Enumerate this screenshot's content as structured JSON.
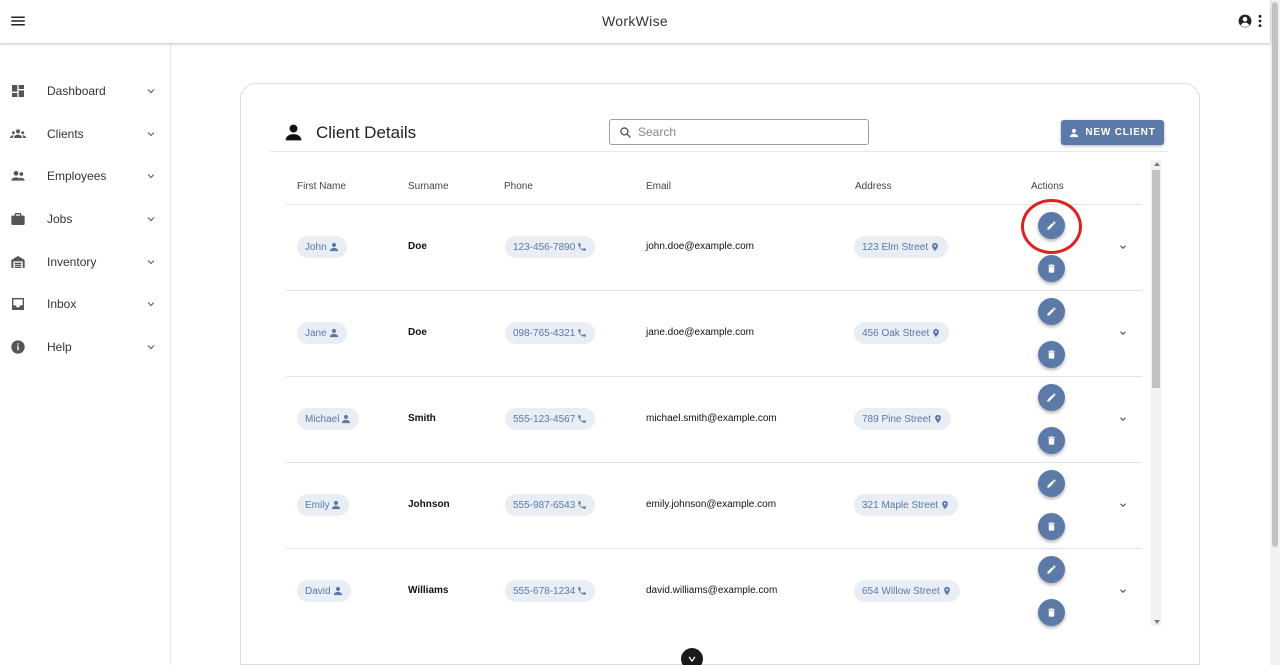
{
  "app": {
    "title": "WorkWise"
  },
  "sidebar": {
    "items": [
      {
        "label": "Dashboard",
        "icon": "dashboard-icon"
      },
      {
        "label": "Clients",
        "icon": "groups-icon"
      },
      {
        "label": "Employees",
        "icon": "people-icon"
      },
      {
        "label": "Jobs",
        "icon": "briefcase-icon"
      },
      {
        "label": "Inventory",
        "icon": "warehouse-icon"
      },
      {
        "label": "Inbox",
        "icon": "inbox-icon"
      },
      {
        "label": "Help",
        "icon": "info-icon"
      }
    ]
  },
  "card": {
    "title": "Client Details",
    "search": {
      "placeholder": "Search",
      "value": ""
    },
    "new_client_label": "NEW CLIENT"
  },
  "table": {
    "headers": [
      "First Name",
      "Surname",
      "Phone",
      "Email",
      "Address",
      "Actions"
    ],
    "rows": [
      {
        "first": "John",
        "surname": "Doe",
        "phone": "123-456-7890",
        "email": "john.doe@example.com",
        "address": "123 Elm Street"
      },
      {
        "first": "Jane",
        "surname": "Doe",
        "phone": "098-765-4321",
        "email": "jane.doe@example.com",
        "address": "456 Oak Street"
      },
      {
        "first": "Michael",
        "surname": "Smith",
        "phone": "555-123-4567",
        "email": "michael.smith@example.com",
        "address": "789 Pine Street"
      },
      {
        "first": "Emily",
        "surname": "Johnson",
        "phone": "555-987-6543",
        "email": "emily.johnson@example.com",
        "address": "321 Maple Street"
      },
      {
        "first": "David",
        "surname": "Williams",
        "phone": "555-678-1234",
        "email": "david.williams@example.com",
        "address": "654 Willow Street"
      }
    ]
  },
  "colors": {
    "accent": "#5b7aa8",
    "chip_bg": "#e9edf4",
    "highlight": "#e0201e"
  }
}
